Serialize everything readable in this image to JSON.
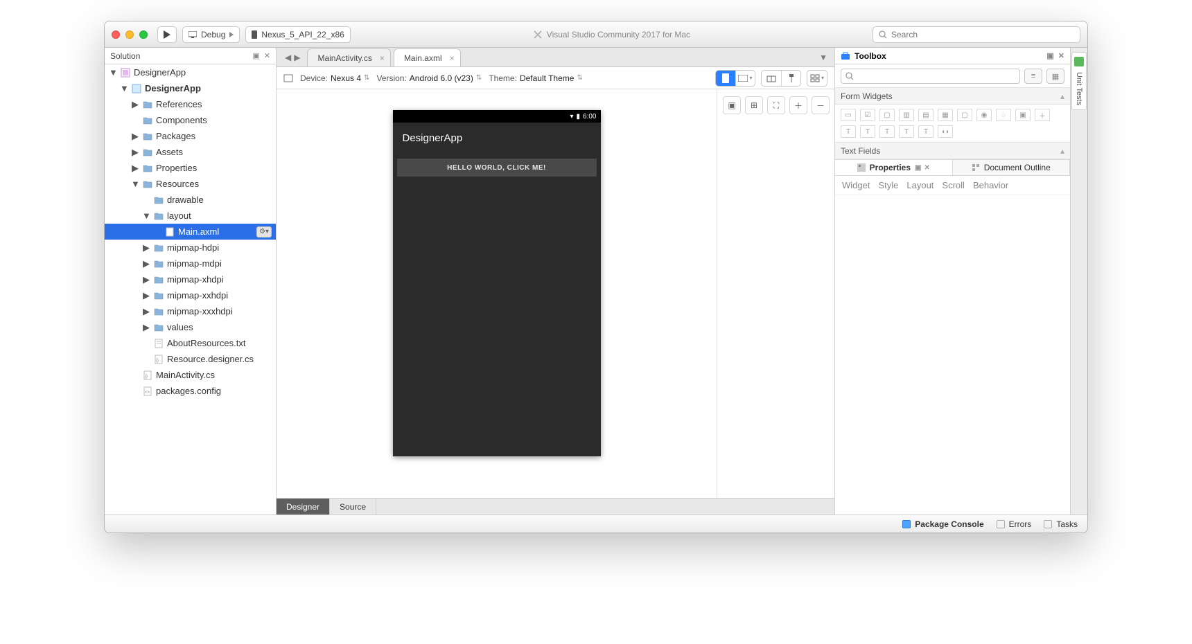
{
  "titlebar": {
    "config_label": "Debug",
    "device_label": "Nexus_5_API_22_x86",
    "app_title": "Visual Studio Community 2017 for Mac",
    "search_placeholder": "Search"
  },
  "solution": {
    "pane_title": "Solution",
    "root": "DesignerApp",
    "project": "DesignerApp",
    "items": [
      "References",
      "Components",
      "Packages",
      "Assets",
      "Properties"
    ],
    "resources_label": "Resources",
    "drawable": "drawable",
    "layout": "layout",
    "main_axml": "Main.axml",
    "mipmaps": [
      "mipmap-hdpi",
      "mipmap-mdpi",
      "mipmap-xhdpi",
      "mipmap-xxhdpi",
      "mipmap-xxxhdpi"
    ],
    "values": "values",
    "about_resources": "AboutResources.txt",
    "resource_designer": "Resource.designer.cs",
    "main_activity": "MainActivity.cs",
    "packages_config": "packages.config"
  },
  "editor": {
    "tabs": [
      {
        "label": "MainActivity.cs",
        "active": false
      },
      {
        "label": "Main.axml",
        "active": true
      }
    ],
    "device_label": "Device:",
    "device_value": "Nexus 4",
    "version_label": "Version:",
    "version_value": "Android 6.0 (v23)",
    "theme_label": "Theme:",
    "theme_value": "Default Theme",
    "statusbar_time": "6:00",
    "app_title": "DesignerApp",
    "hello_button": "HELLO WORLD, CLICK ME!",
    "bottom_tabs": {
      "designer": "Designer",
      "source": "Source"
    }
  },
  "toolbox": {
    "title": "Toolbox",
    "form_widgets": "Form Widgets",
    "text_fields": "Text Fields"
  },
  "properties": {
    "prop_tab": "Properties",
    "outline_tab": "Document Outline",
    "filters": [
      "Widget",
      "Style",
      "Layout",
      "Scroll",
      "Behavior"
    ]
  },
  "vtab": {
    "label": "Unit Tests"
  },
  "statusbar": {
    "package_console": "Package Console",
    "errors": "Errors",
    "tasks": "Tasks"
  }
}
